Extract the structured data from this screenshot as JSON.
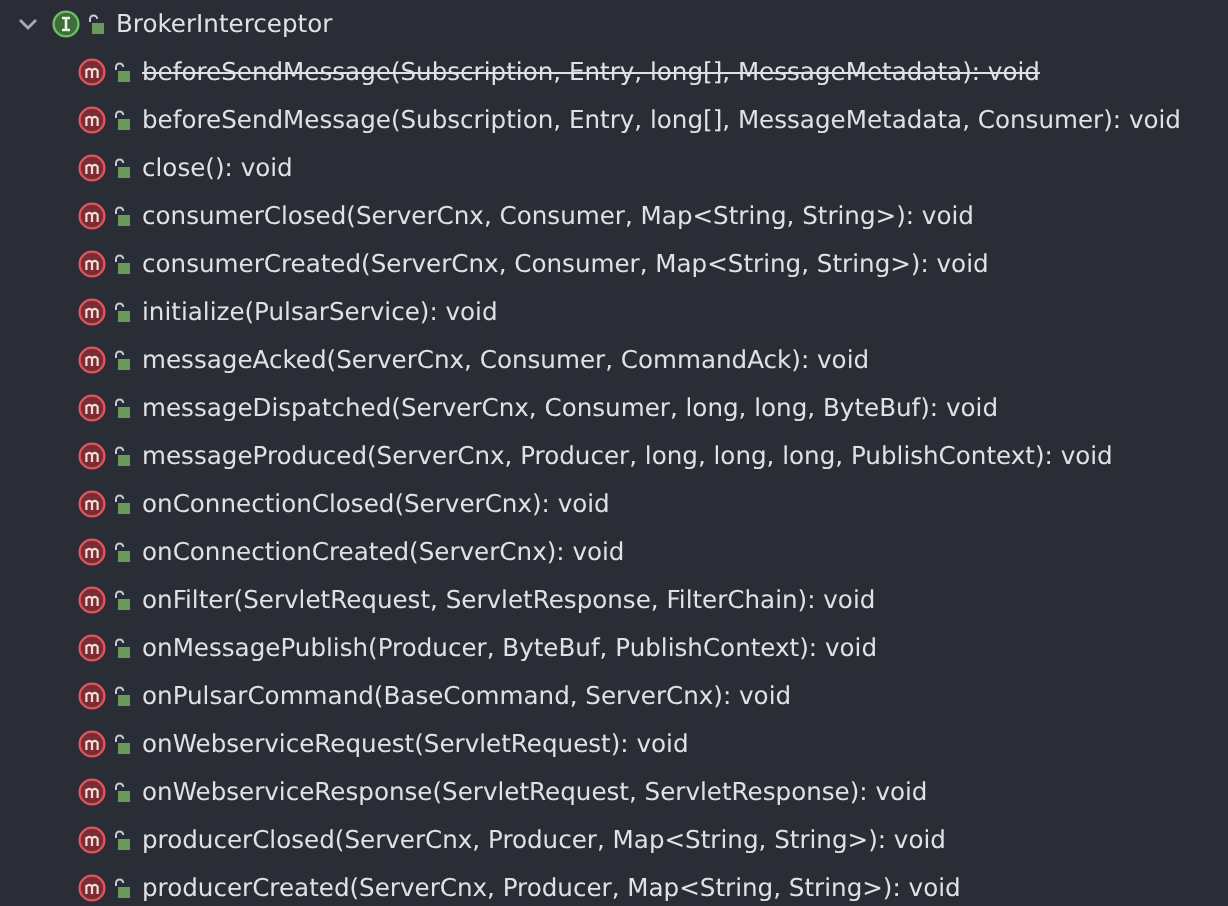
{
  "tree": {
    "label": "BrokerInterceptor",
    "expanded": true,
    "children": [
      {
        "label": "beforeSendMessage(Subscription, Entry, long[], MessageMetadata): void",
        "deprecated": true
      },
      {
        "label": "beforeSendMessage(Subscription, Entry, long[], MessageMetadata, Consumer): void",
        "deprecated": false
      },
      {
        "label": "close(): void",
        "deprecated": false
      },
      {
        "label": "consumerClosed(ServerCnx, Consumer, Map<String, String>): void",
        "deprecated": false
      },
      {
        "label": "consumerCreated(ServerCnx, Consumer, Map<String, String>): void",
        "deprecated": false
      },
      {
        "label": "initialize(PulsarService): void",
        "deprecated": false
      },
      {
        "label": "messageAcked(ServerCnx, Consumer, CommandAck): void",
        "deprecated": false
      },
      {
        "label": "messageDispatched(ServerCnx, Consumer, long, long, ByteBuf): void",
        "deprecated": false
      },
      {
        "label": "messageProduced(ServerCnx, Producer, long, long, long, PublishContext): void",
        "deprecated": false
      },
      {
        "label": "onConnectionClosed(ServerCnx): void",
        "deprecated": false
      },
      {
        "label": "onConnectionCreated(ServerCnx): void",
        "deprecated": false
      },
      {
        "label": "onFilter(ServletRequest, ServletResponse, FilterChain): void",
        "deprecated": false
      },
      {
        "label": "onMessagePublish(Producer, ByteBuf, PublishContext): void",
        "deprecated": false
      },
      {
        "label": "onPulsarCommand(BaseCommand, ServerCnx): void",
        "deprecated": false
      },
      {
        "label": "onWebserviceRequest(ServletRequest): void",
        "deprecated": false
      },
      {
        "label": "onWebserviceResponse(ServletRequest, ServletResponse): void",
        "deprecated": false
      },
      {
        "label": "producerClosed(ServerCnx, Producer, Map<String, String>): void",
        "deprecated": false
      },
      {
        "label": "producerCreated(ServerCnx, Producer, Map<String, String>): void",
        "deprecated": false
      }
    ]
  }
}
